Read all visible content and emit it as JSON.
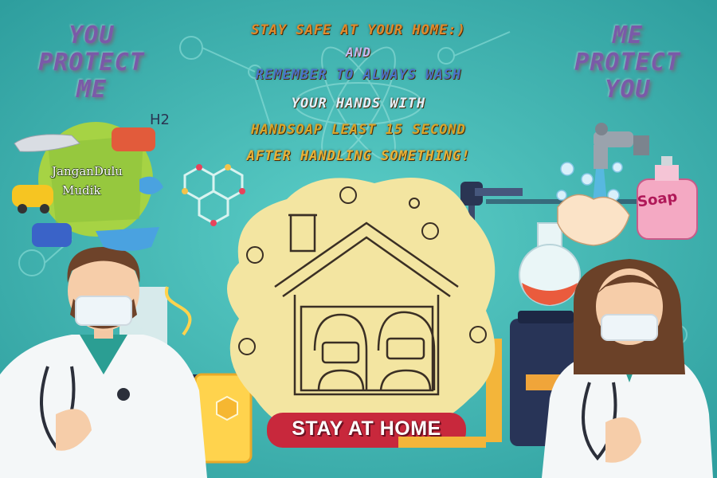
{
  "left_slogan": {
    "line1": "YOU",
    "line2": "PROTECT",
    "line3": "ME"
  },
  "right_slogan": {
    "line1": "ME",
    "line2": "PROTECT",
    "line3": "YOU"
  },
  "message": {
    "line1": "STAY SAFE AT YOUR HOME:)",
    "line2": "AND",
    "line3": "REMEMBER TO ALWAYS WASH",
    "line4": "YOUR HANDS WITH",
    "line5": "HANDSOAP LEAST 15 SECOND",
    "line6": "AFTER HANDLING SOMETHING!"
  },
  "mudik_badge": {
    "line1": "JanganDulu",
    "line2": "Mudik"
  },
  "soap_label": "Soap",
  "formula_label": "H2",
  "stay_home_label": "STAY AT HOME",
  "colors": {
    "background": "#3fb8b4",
    "stay_home_red": "#c8283c",
    "house_blob": "#f3e5a1",
    "slogan": "#7a5aa8"
  }
}
